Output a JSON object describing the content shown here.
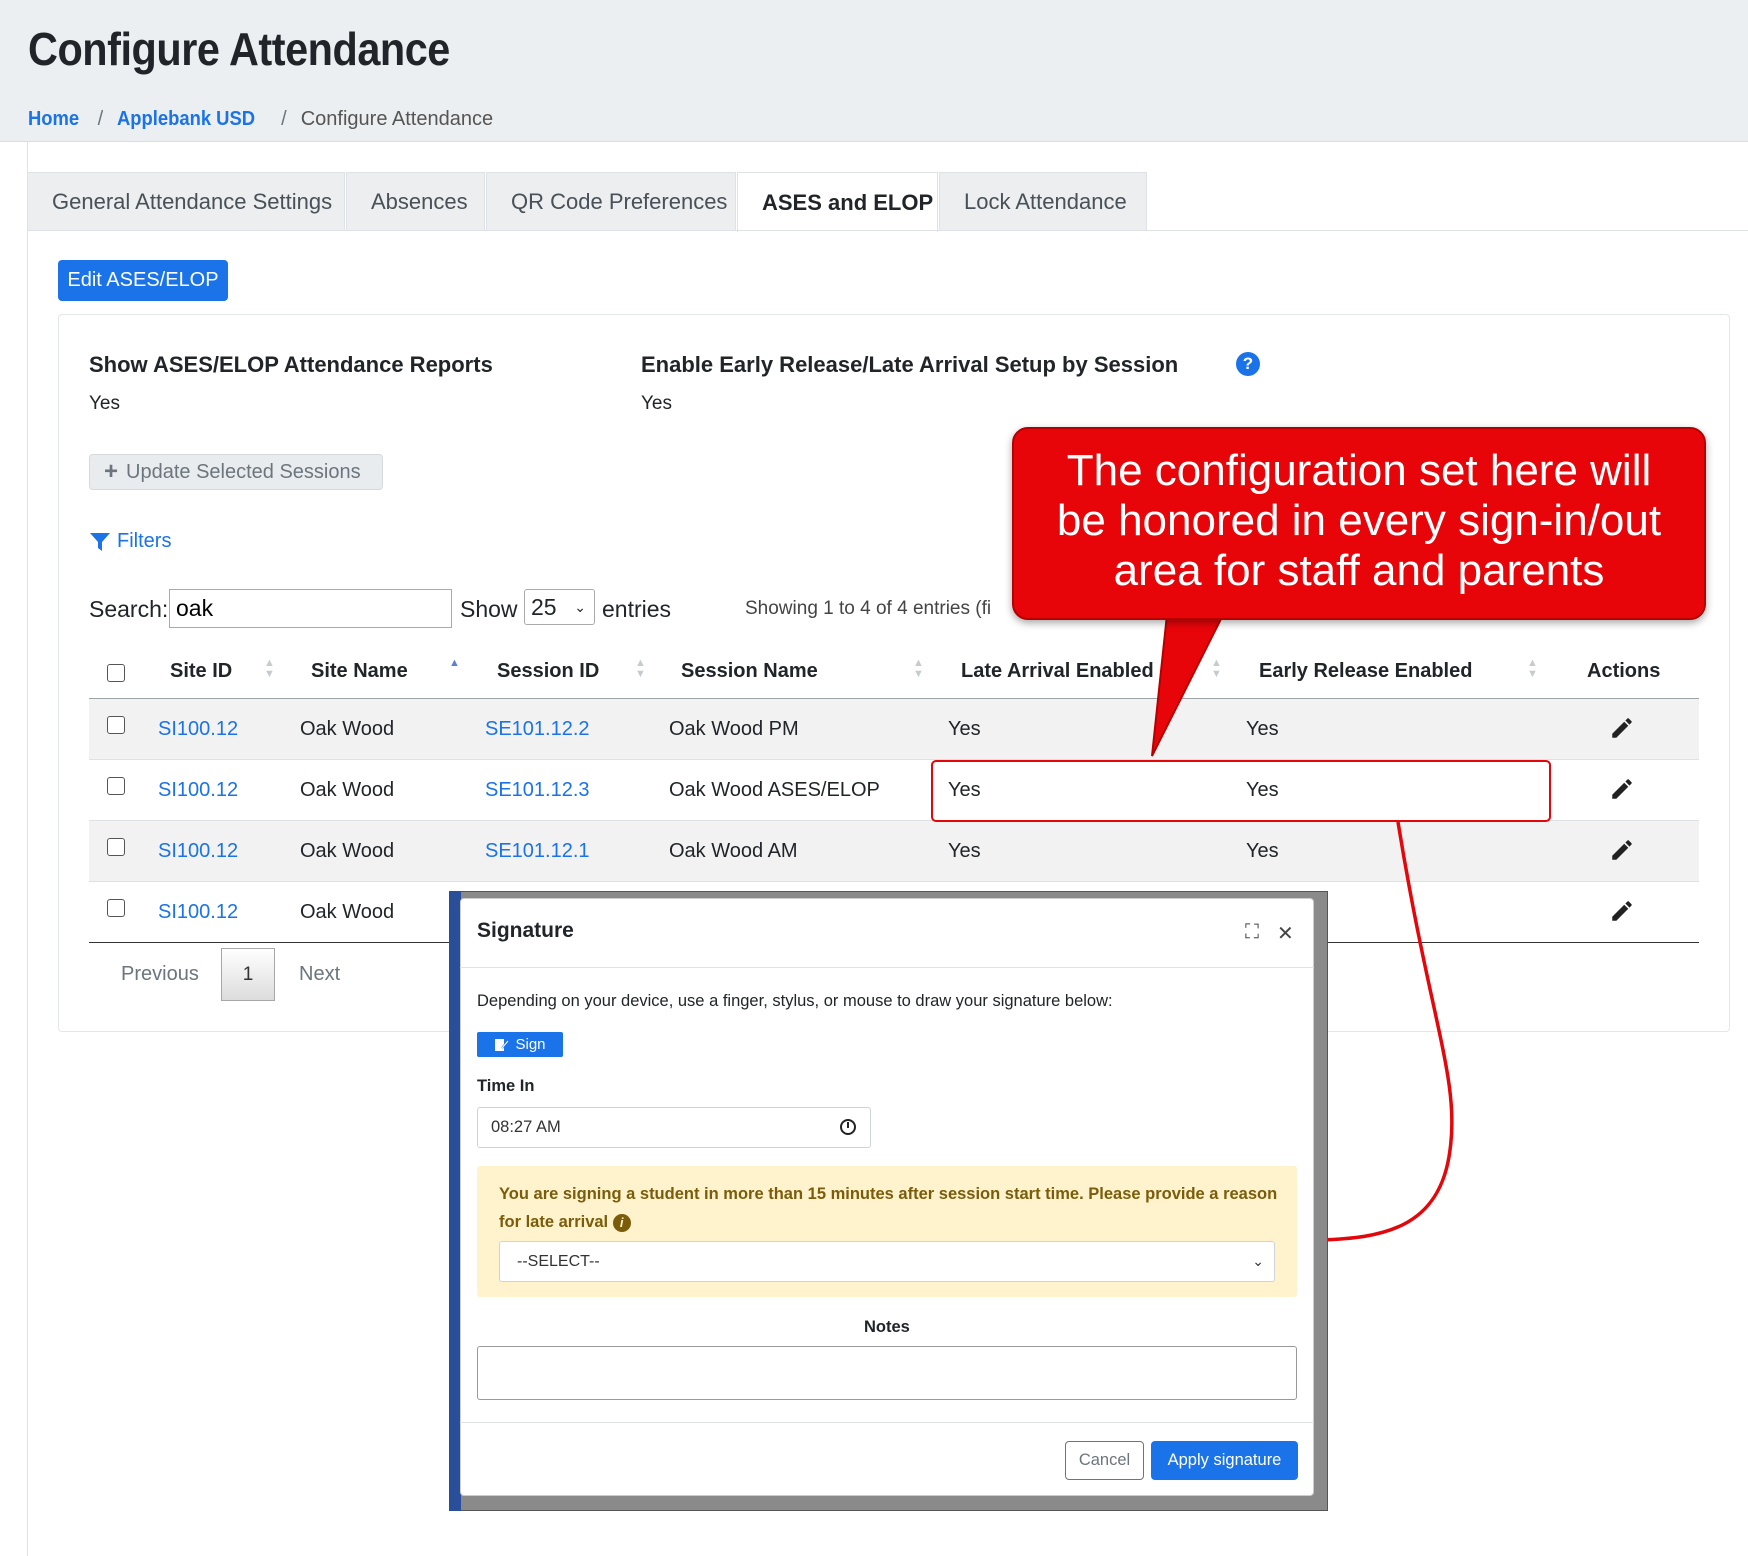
{
  "header": {
    "title": "Configure Attendance",
    "breadcrumb": {
      "home": "Home",
      "district": "Applebank USD",
      "current": "Configure Attendance",
      "separator": "/"
    }
  },
  "tabs": [
    "General Attendance Settings",
    "Absences",
    "QR Code Preferences",
    "ASES and ELOP",
    "Lock Attendance"
  ],
  "active_tab": "ASES and ELOP",
  "edit_button": "Edit ASES/ELOP",
  "settings": {
    "show_reports_label": "Show ASES/ELOP Attendance Reports",
    "show_reports_value": "Yes",
    "early_release_label": "Enable Early Release/Late Arrival Setup by Session",
    "early_release_value": "Yes",
    "help_icon": "?"
  },
  "update_button": "Update Selected Sessions",
  "filters_label": "Filters",
  "search": {
    "label": "Search:",
    "value": "oak"
  },
  "page_length": {
    "show_label": "Show",
    "value": "25",
    "entries_label": "entries"
  },
  "showing_info": "Showing 1 to 4 of 4 entries (fi",
  "table": {
    "columns": [
      "Site ID",
      "Site Name",
      "Session ID",
      "Session Name",
      "Late Arrival Enabled",
      "Early Release Enabled",
      "Actions"
    ],
    "rows": [
      {
        "site_id": "SI100.12",
        "site_name": "Oak Wood",
        "session_id": "SE101.12.2",
        "session_name": "Oak Wood PM",
        "late": "Yes",
        "early": "Yes"
      },
      {
        "site_id": "SI100.12",
        "site_name": "Oak Wood",
        "session_id": "SE101.12.3",
        "session_name": "Oak Wood ASES/ELOP",
        "late": "Yes",
        "early": "Yes"
      },
      {
        "site_id": "SI100.12",
        "site_name": "Oak Wood",
        "session_id": "SE101.12.1",
        "session_name": "Oak Wood AM",
        "late": "Yes",
        "early": "Yes"
      },
      {
        "site_id": "SI100.12",
        "site_name": "Oak Wood"
      }
    ]
  },
  "pagination": {
    "previous": "Previous",
    "current": "1",
    "next": "Next"
  },
  "callout": {
    "line1": "The configuration set here will",
    "line2": "be honored in every sign-in/out",
    "line3": "area for staff and parents",
    "color": "#e8050a"
  },
  "modal": {
    "title": "Signature",
    "instructions": "Depending on your device, use a finger, stylus, or mouse to draw your signature below:",
    "sign_button": "Sign",
    "time_in_label": "Time In",
    "time_in_value": "08:27 AM",
    "warning": "You are signing a student in more than 15 minutes after session start time. Please provide a reason for late arrival",
    "reason_placeholder": "--SELECT--",
    "notes_label": "Notes",
    "cancel_button": "Cancel",
    "apply_button": "Apply signature"
  },
  "colors": {
    "primary": "#1a73e8",
    "warning_bg": "#fff3cd",
    "warning_text": "#7a5c0a",
    "header_bg": "#eceff1"
  }
}
